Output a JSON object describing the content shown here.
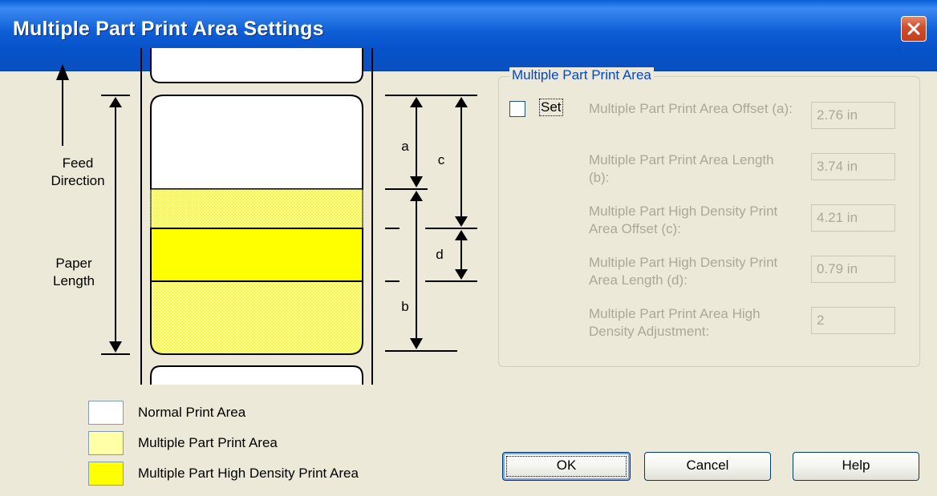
{
  "window": {
    "title": "Multiple Part Print Area Settings"
  },
  "diagram": {
    "feed_direction": "Feed\nDirection",
    "paper_length": "Paper\nLength",
    "labels": {
      "a": "a",
      "b": "b",
      "c": "c",
      "d": "d"
    }
  },
  "legend": [
    {
      "label": "Normal Print Area",
      "color": "#FFFFFF"
    },
    {
      "label": "Multiple Part Print Area",
      "color": "#FFFFA8"
    },
    {
      "label": "Multiple Part High Density Print Area",
      "color": "#FFFF00"
    }
  ],
  "group": {
    "title": "Multiple Part Print Area",
    "set_label": "Set",
    "set_checked": false,
    "fields": [
      {
        "label": "Multiple Part Print Area Offset (a):",
        "value": "2.76 in"
      },
      {
        "label": "Multiple Part Print Area Length (b):",
        "value": "3.74 in"
      },
      {
        "label": "Multiple Part High Density Print Area Offset (c):",
        "value": "4.21 in"
      },
      {
        "label": "Multiple Part High Density Print Area Length (d):",
        "value": "0.79 in"
      },
      {
        "label": "Multiple Part Print Area High Density Adjustment:",
        "value": "2"
      }
    ]
  },
  "buttons": {
    "ok": "OK",
    "cancel": "Cancel",
    "help": "Help"
  },
  "colors": {
    "titlebar": "#0A5FD8",
    "group_title": "#0046D5",
    "disabled_text": "#ACA899",
    "yellow": "#FFFF00",
    "light_yellow": "#FFFFA8"
  }
}
